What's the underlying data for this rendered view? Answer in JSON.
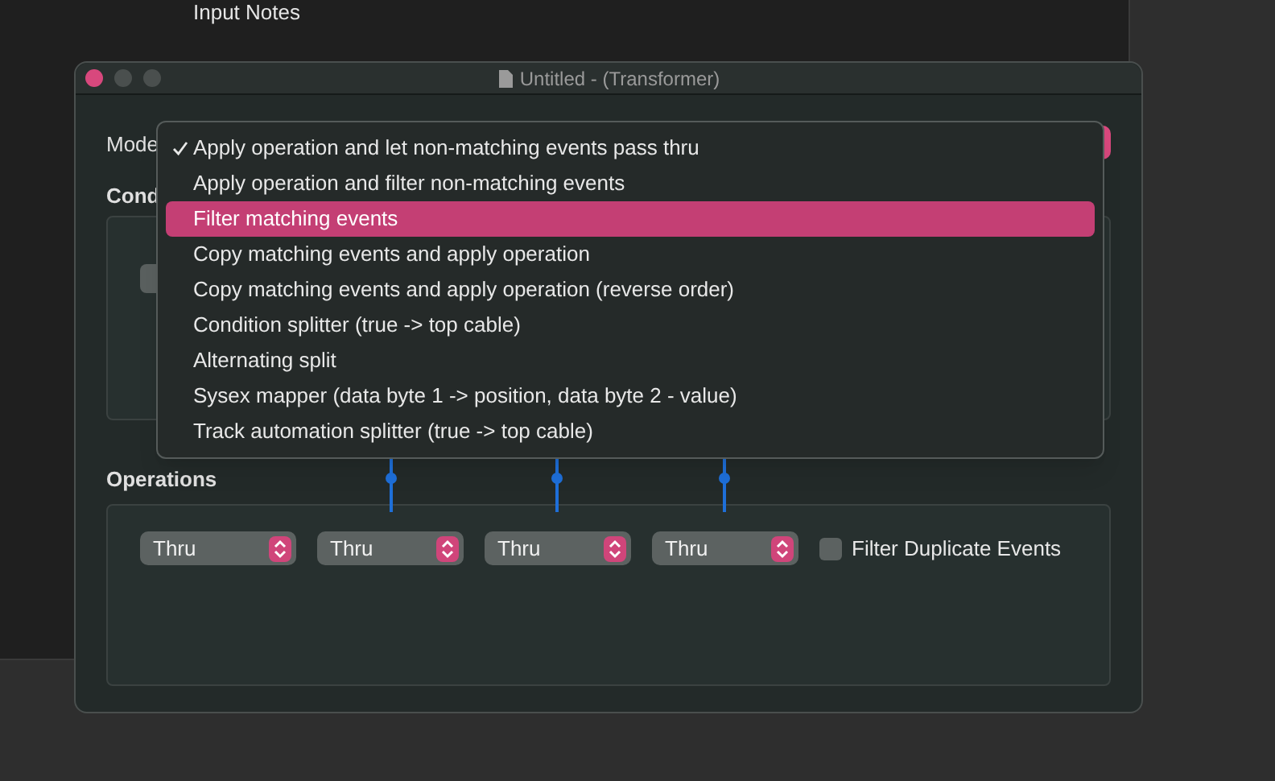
{
  "background_window": {
    "text": "Input Notes"
  },
  "window": {
    "title": "Untitled - (Transformer)"
  },
  "mode": {
    "label": "Mode"
  },
  "conditions": {
    "label": "Cond"
  },
  "menu": {
    "items": [
      {
        "label": "Apply operation and let non-matching events pass thru",
        "checked": true,
        "selected": false
      },
      {
        "label": "Apply operation and filter non-matching events",
        "checked": false,
        "selected": false
      },
      {
        "label": "Filter matching events",
        "checked": false,
        "selected": true
      },
      {
        "label": "Copy matching events and apply operation",
        "checked": false,
        "selected": false
      },
      {
        "label": "Copy matching events and apply operation (reverse order)",
        "checked": false,
        "selected": false
      },
      {
        "label": "Condition splitter (true -> top cable)",
        "checked": false,
        "selected": false
      },
      {
        "label": "Alternating split",
        "checked": false,
        "selected": false
      },
      {
        "label": "Sysex mapper (data byte 1 -> position, data byte 2 - value)",
        "checked": false,
        "selected": false
      },
      {
        "label": "Track automation splitter (true -> top cable)",
        "checked": false,
        "selected": false
      }
    ]
  },
  "operations": {
    "label": "Operations",
    "selects": [
      {
        "value": "Thru"
      },
      {
        "value": "Thru"
      },
      {
        "value": "Thru"
      },
      {
        "value": "Thru"
      }
    ],
    "filter_duplicates": {
      "label": "Filter Duplicate Events",
      "checked": false
    }
  }
}
